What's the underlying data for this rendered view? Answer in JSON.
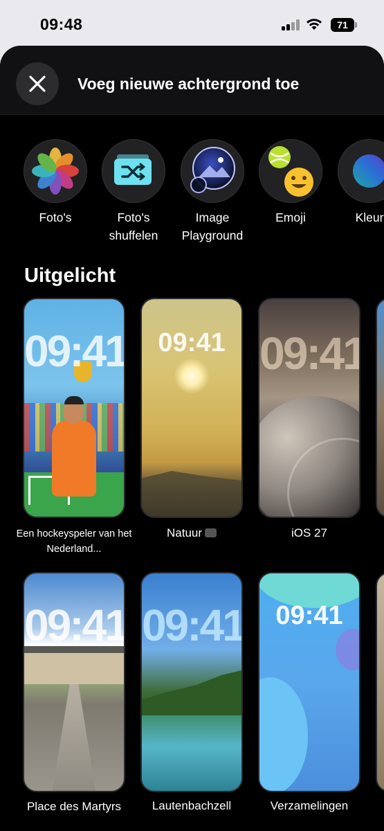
{
  "status_bar": {
    "time": "09:48",
    "battery": "71"
  },
  "header": {
    "title": "Voeg nieuwe achtergrond toe"
  },
  "sources": [
    {
      "label": "Foto's",
      "icon": "photos-icon"
    },
    {
      "label": "Foto's\nshuffelen",
      "icon": "photo-shuffle-icon"
    },
    {
      "label": "Image\nPlayground",
      "icon": "image-playground-icon"
    },
    {
      "label": "Emoji",
      "icon": "emoji-icon"
    },
    {
      "label": "Kleur",
      "icon": "color-icon"
    }
  ],
  "featured": {
    "title": "Uitgelicht",
    "wallpapers": [
      {
        "time": "09:41",
        "caption": "Een hockeyspeler\nvan het Nederland..."
      },
      {
        "time": "09:41",
        "caption": "Natuur"
      },
      {
        "time": "09:41",
        "caption": "iOS 27"
      },
      {
        "time": "09:41",
        "caption": "Place des\nMartyrs"
      },
      {
        "time": "09:41",
        "caption": "Lautenbachzell"
      },
      {
        "time": "09:41",
        "caption": "Verzamelingen"
      }
    ]
  }
}
